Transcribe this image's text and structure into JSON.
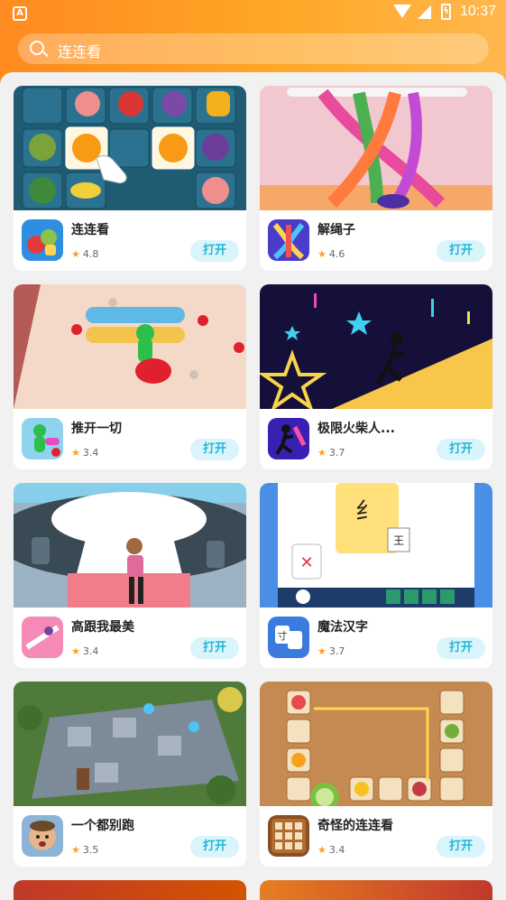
{
  "status_bar": {
    "time": "10:37",
    "app_icon_letter": "A",
    "battery_glyph": "ϟ"
  },
  "search": {
    "placeholder": "连连看",
    "icon": "search-icon"
  },
  "open_label": "打开",
  "star_glyph": "★",
  "colors": {
    "header_start": "#ff8a1f",
    "header_end": "#ffb74d",
    "button_bg": "#d9f4fb",
    "button_text": "#23b6d8",
    "star": "#ff9f1c"
  },
  "games": [
    {
      "name": "连连看",
      "rating": "4.8"
    },
    {
      "name": "解绳子",
      "rating": "4.6"
    },
    {
      "name": "推开一切",
      "rating": "3.4"
    },
    {
      "name": "极限火柴人...",
      "rating": "3.7"
    },
    {
      "name": "高跟我最美",
      "rating": "3.4"
    },
    {
      "name": "魔法汉字",
      "rating": "3.7"
    },
    {
      "name": "一个都别跑",
      "rating": "3.5"
    },
    {
      "name": "奇怪的连连看",
      "rating": "3.4"
    }
  ]
}
